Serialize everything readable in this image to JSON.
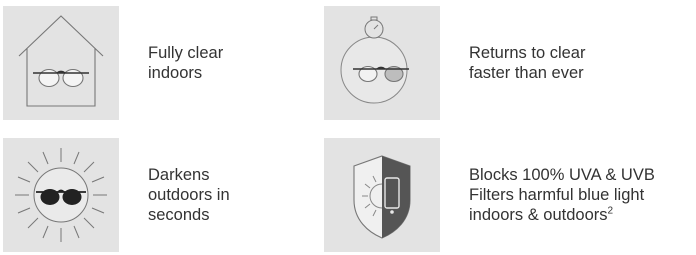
{
  "features": [
    {
      "icon": "house-glasses-icon",
      "lines": [
        "Fully clear",
        "indoors"
      ]
    },
    {
      "icon": "stopwatch-glasses-icon",
      "lines": [
        "Returns to clear",
        "faster than ever"
      ]
    },
    {
      "icon": "sun-sunglasses-icon",
      "lines": [
        "Darkens",
        "outdoors in",
        "seconds"
      ]
    },
    {
      "icon": "shield-phone-icon",
      "lines": [
        "Blocks 100% UVA & UVB",
        "Filters harmful blue light",
        "indoors & outdoors"
      ],
      "footnote": "2"
    }
  ],
  "colors": {
    "tile_background": "#e3e3e3",
    "text": "#333333",
    "line_art": "#777777"
  }
}
